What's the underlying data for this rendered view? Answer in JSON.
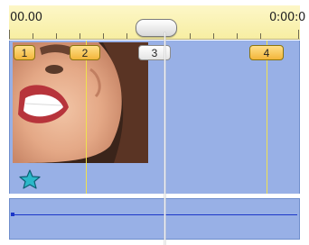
{
  "ruler": {
    "start_time": "00.00",
    "end_time": "0:00:0"
  },
  "markers": [
    {
      "label": "1"
    },
    {
      "label": "2"
    },
    {
      "label": "3"
    },
    {
      "label": "4"
    }
  ],
  "colors": {
    "ruler_bg": "#f7eea2",
    "track_bg": "#98b0e6",
    "marker_fill": "#f2b53a",
    "marker_line": "#f1e24d",
    "audio_line": "#1b36c8",
    "star": "#2bb8c9"
  },
  "icons": {
    "clip_star": "star-icon",
    "scrub_handle": "scrubber-handle"
  }
}
